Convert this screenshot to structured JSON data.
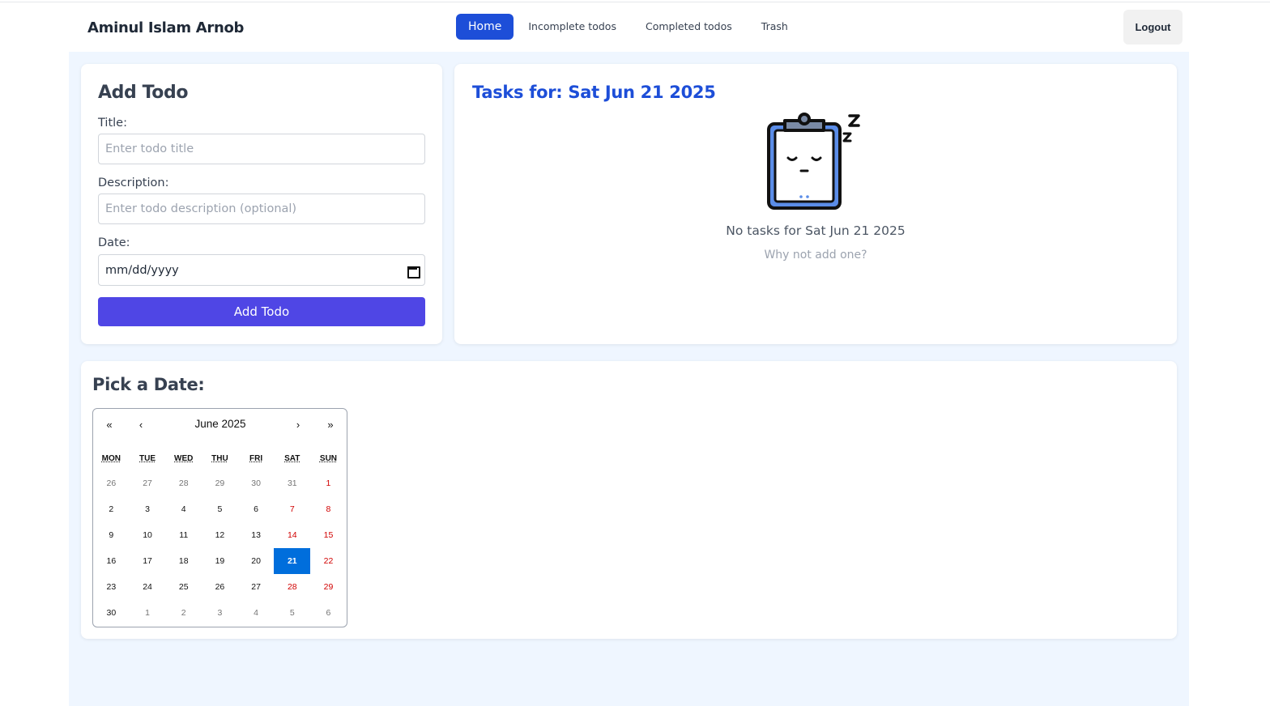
{
  "header": {
    "brand": "Aminul Islam Arnob",
    "nav": [
      {
        "label": "Home",
        "active": true
      },
      {
        "label": "Incomplete todos",
        "active": false
      },
      {
        "label": "Completed todos",
        "active": false
      },
      {
        "label": "Trash",
        "active": false
      }
    ],
    "logout_label": "Logout"
  },
  "add_todo": {
    "title": "Add Todo",
    "title_label": "Title:",
    "title_placeholder": "Enter todo title",
    "description_label": "Description:",
    "description_placeholder": "Enter todo description (optional)",
    "date_label": "Date:",
    "date_placeholder": "mm/dd/yyyy",
    "submit_label": "Add Todo",
    "button_color": "#4f46e5"
  },
  "tasks": {
    "title": "Tasks for: Sat Jun 21 2025",
    "empty_message": "No tasks for Sat Jun 21 2025",
    "empty_sub": "Why not add one?",
    "title_color": "#1d4ed8"
  },
  "picker": {
    "title": "Pick a Date:",
    "nav_prev_year": "«",
    "nav_prev_month": "‹",
    "nav_next_month": "›",
    "nav_next_year": "»",
    "month_label": "June 2025",
    "weekdays": [
      "MON",
      "TUE",
      "WED",
      "THU",
      "FRI",
      "SAT",
      "SUN"
    ],
    "days": [
      {
        "d": "26",
        "other": true
      },
      {
        "d": "27",
        "other": true
      },
      {
        "d": "28",
        "other": true
      },
      {
        "d": "29",
        "other": true
      },
      {
        "d": "30",
        "other": true
      },
      {
        "d": "31",
        "other": true
      },
      {
        "d": "1",
        "weekend": true
      },
      {
        "d": "2"
      },
      {
        "d": "3"
      },
      {
        "d": "4"
      },
      {
        "d": "5"
      },
      {
        "d": "6"
      },
      {
        "d": "7",
        "weekend": true
      },
      {
        "d": "8",
        "weekend": true
      },
      {
        "d": "9"
      },
      {
        "d": "10"
      },
      {
        "d": "11"
      },
      {
        "d": "12"
      },
      {
        "d": "13"
      },
      {
        "d": "14",
        "weekend": true
      },
      {
        "d": "15",
        "weekend": true
      },
      {
        "d": "16"
      },
      {
        "d": "17"
      },
      {
        "d": "18"
      },
      {
        "d": "19"
      },
      {
        "d": "20"
      },
      {
        "d": "21",
        "selected": true
      },
      {
        "d": "22",
        "weekend": true
      },
      {
        "d": "23"
      },
      {
        "d": "24"
      },
      {
        "d": "25"
      },
      {
        "d": "26"
      },
      {
        "d": "27"
      },
      {
        "d": "28",
        "weekend": true
      },
      {
        "d": "29",
        "weekend": true
      },
      {
        "d": "30"
      },
      {
        "d": "1",
        "other": true
      },
      {
        "d": "2",
        "other": true
      },
      {
        "d": "3",
        "other": true
      },
      {
        "d": "4",
        "other": true
      },
      {
        "d": "5",
        "other": true
      },
      {
        "d": "6",
        "other": true
      }
    ],
    "selected_color": "#006edc",
    "weekend_color": "#d10000"
  },
  "icons": {
    "date_picker": "calendar-icon",
    "empty_state": "sleeping-clipboard-icon"
  }
}
